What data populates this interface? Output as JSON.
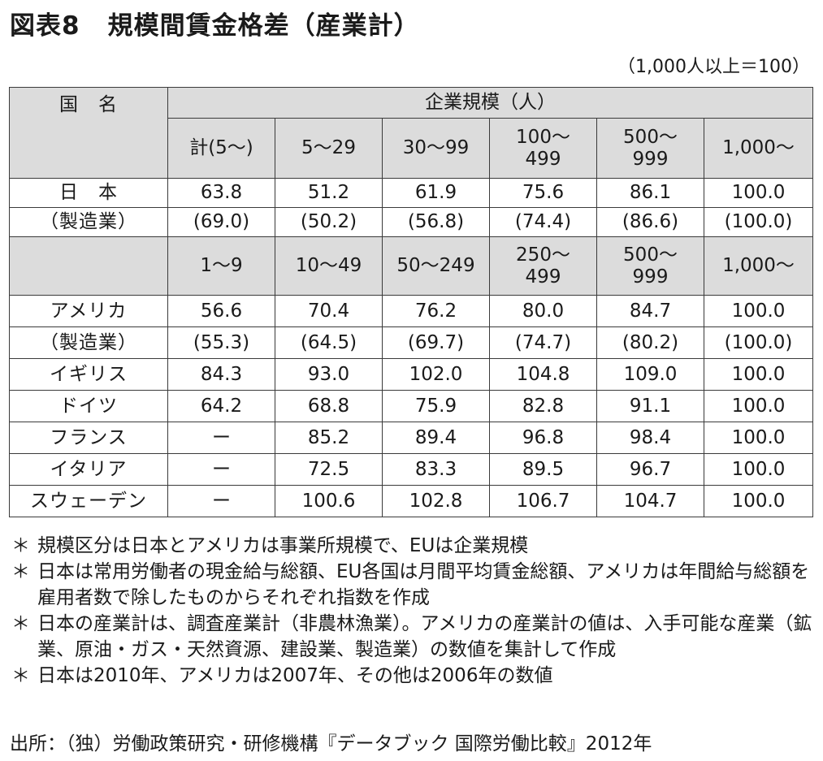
{
  "title": {
    "number": "図表8",
    "text": "規模間賃金格差（産業計）"
  },
  "unit_note": "（1,000人以上＝100）",
  "table": {
    "country_header": "国　名",
    "group_header": "企業規模（人）",
    "jp_columns": [
      "計(5〜)",
      "5〜29",
      "30〜99",
      "100〜\n499",
      "500〜\n999",
      "1,000〜"
    ],
    "jp_rows": [
      {
        "label": "日　本",
        "values": [
          "63.8",
          "51.2",
          "61.9",
          "75.6",
          "86.1",
          "100.0"
        ]
      },
      {
        "label": "（製造業）",
        "values": [
          "(69.0)",
          "(50.2)",
          "(56.8)",
          "(74.4)",
          "(86.6)",
          "(100.0)"
        ]
      }
    ],
    "other_columns": [
      "1〜9",
      "10〜49",
      "50〜249",
      "250〜\n499",
      "500〜\n999",
      "1,000〜"
    ],
    "other_rows": [
      {
        "label": "アメリカ",
        "values": [
          "56.6",
          "70.4",
          "76.2",
          "80.0",
          "84.7",
          "100.0"
        ]
      },
      {
        "label": "（製造業）",
        "values": [
          "(55.3)",
          "(64.5)",
          "(69.7)",
          "(74.7)",
          "(80.2)",
          "(100.0)"
        ]
      },
      {
        "label": "イギリス",
        "values": [
          "84.3",
          "93.0",
          "102.0",
          "104.8",
          "109.0",
          "100.0"
        ]
      },
      {
        "label": "ドイツ",
        "values": [
          "64.2",
          "68.8",
          "75.9",
          "82.8",
          "91.1",
          "100.0"
        ]
      },
      {
        "label": "フランス",
        "values": [
          "ー",
          "85.2",
          "89.4",
          "96.8",
          "98.4",
          "100.0"
        ]
      },
      {
        "label": "イタリア",
        "values": [
          "ー",
          "72.5",
          "83.3",
          "89.5",
          "96.7",
          "100.0"
        ]
      },
      {
        "label": "スウェーデン",
        "values": [
          "ー",
          "100.6",
          "102.8",
          "106.7",
          "104.7",
          "100.0"
        ]
      }
    ]
  },
  "notes": [
    "規模区分は日本とアメリカは事業所規模で、EUは企業規模",
    "日本は常用労働者の現金給与総額、EU各国は月間平均賃金総額、アメリカは年間給与総額を雇用者数で除したものからそれぞれ指数を作成",
    "日本の産業計は、調査産業計（非農林漁業）。アメリカの産業計の値は、入手可能な産業（鉱業、原油・ガス・天然資源、建設業、製造業）の数値を集計して作成",
    "日本は2010年、アメリカは2007年、その他は2006年の数値"
  ],
  "note_marker": "＊",
  "source": "出所：（独）労働政策研究・研修機構『データブック 国際労働比較』2012年"
}
